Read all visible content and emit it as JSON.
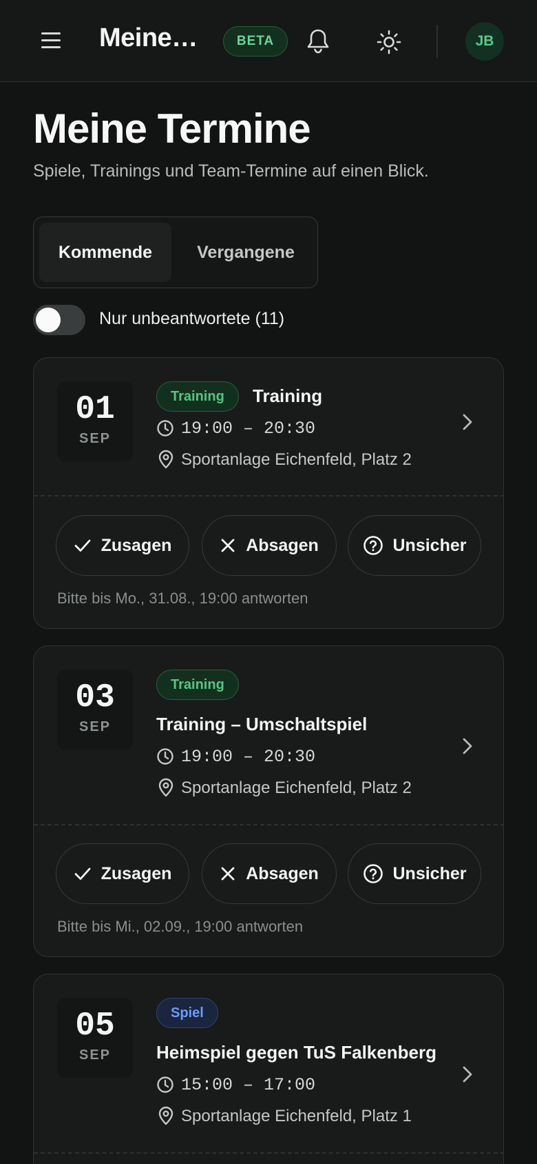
{
  "header": {
    "title": "Meine…",
    "badge": "BETA",
    "avatar_initials": "JB",
    "icons": [
      "menu-icon",
      "bell-icon",
      "sun-icon"
    ]
  },
  "page": {
    "title": "Meine Termine",
    "subtitle": "Spiele, Trainings und Team-Termine auf einen Blick."
  },
  "tabs": [
    {
      "label": "Kommende",
      "active": true
    },
    {
      "label": "Vergangene",
      "active": false
    }
  ],
  "filter": {
    "label": "Nur unbeantwortete (11)",
    "enabled": false
  },
  "actions": {
    "accept": "Zusagen",
    "decline": "Absagen",
    "maybe": "Unsicher"
  },
  "events": [
    {
      "day": "01",
      "month": "SEP",
      "type": "Training",
      "title": "Training",
      "time": "19:00 – 20:30",
      "location": "Sportanlage Eichenfeld, Platz 2",
      "deadline": "Bitte bis Mo., 31.08., 19:00 antworten"
    },
    {
      "day": "03",
      "month": "SEP",
      "type": "Training",
      "title": "Training – Umschaltspiel",
      "time": "19:00 – 20:30",
      "location": "Sportanlage Eichenfeld, Platz 2",
      "deadline": "Bitte bis Mi., 02.09., 19:00 antworten"
    },
    {
      "day": "05",
      "month": "SEP",
      "type": "Spiel",
      "title": "Heimspiel gegen TuS Falkenberg",
      "time": "15:00 – 17:00",
      "location": "Sportanlage Eichenfeld, Platz 1"
    }
  ],
  "colors": {
    "background": "#121313",
    "card": "#191a1a",
    "training_badge": "#54c783",
    "spiel_badge": "#6d9cf2",
    "avatar_text": "#58c98a"
  }
}
